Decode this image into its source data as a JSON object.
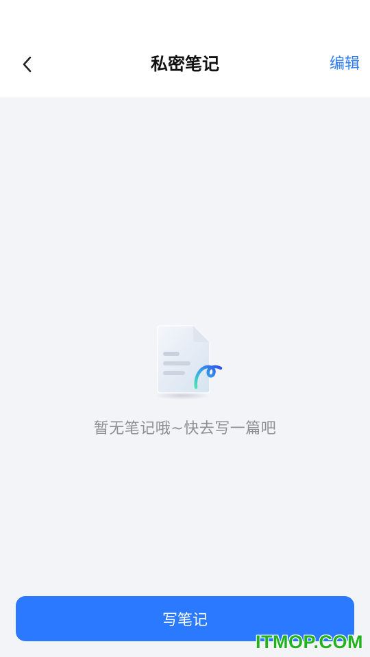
{
  "header": {
    "title": "私密笔记",
    "edit_label": "编辑"
  },
  "empty": {
    "message": "暂无笔记哦~快去写一篇吧"
  },
  "footer": {
    "write_label": "写笔记"
  },
  "watermark": {
    "text": "ITMOP.COM"
  },
  "colors": {
    "accent": "#2a79ff",
    "link": "#2f7cf6",
    "background": "#f3f4f8",
    "watermark": "#22b11f"
  },
  "icons": {
    "back": "chevron-left-icon",
    "empty": "note-document-icon"
  }
}
